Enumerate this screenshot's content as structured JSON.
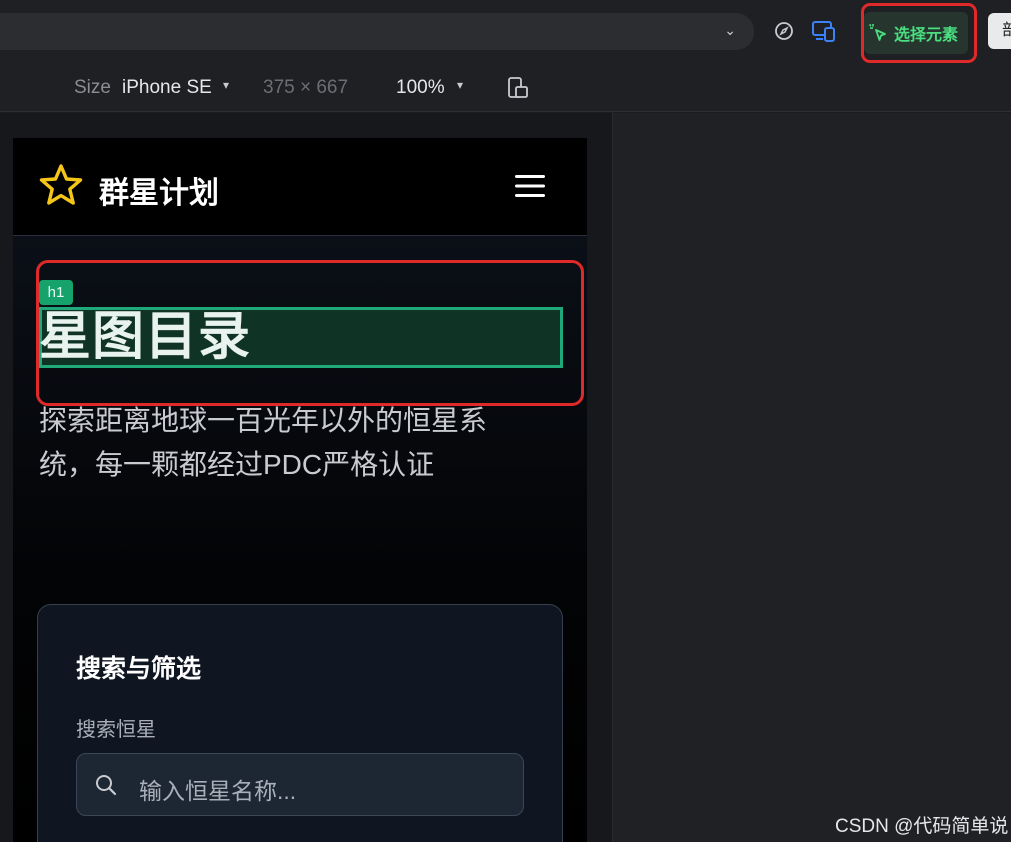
{
  "toolbar": {
    "pick_element_label": "选择元素",
    "extra_button_label": "部"
  },
  "device_bar": {
    "size_label": "Size",
    "device": "iPhone SE",
    "dimensions": "375 × 667",
    "zoom": "100%"
  },
  "site": {
    "brand": "群星计划",
    "h1_tag": "h1",
    "title": "星图目录",
    "description": "探索距离地球一百光年以外的恒星系统，每一颗都经过PDC严格认证",
    "search_card": {
      "title": "搜索与筛选",
      "field_label": "搜索恒星",
      "placeholder": "输入恒星名称..."
    }
  },
  "watermark": "CSDN @代码简单说",
  "colors": {
    "accent_green": "#4ade80",
    "highlight_red": "#e02a2a",
    "star_yellow": "#f5c518",
    "selection_green": "#1fa97a"
  }
}
